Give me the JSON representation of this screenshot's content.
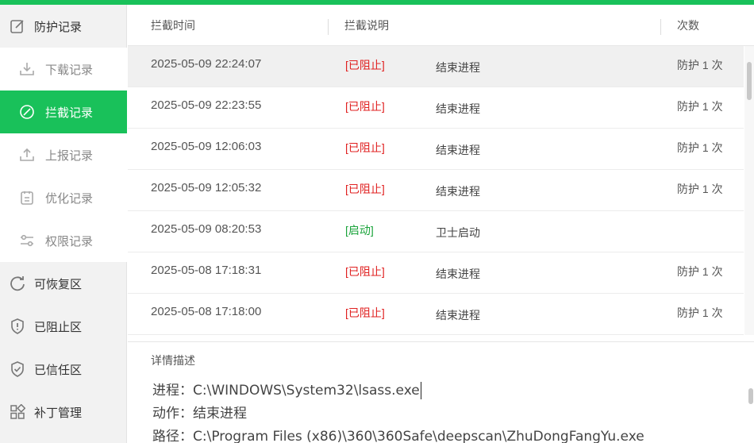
{
  "colors": {
    "accent": "#19c15a",
    "blocked": "#e02020",
    "started": "#19a33a"
  },
  "sidebar": {
    "items": [
      {
        "label": "防护记录",
        "icon": "edit-icon"
      },
      {
        "label": "下载记录",
        "icon": "download-icon"
      },
      {
        "label": "拦截记录",
        "icon": "block-icon"
      },
      {
        "label": "上报记录",
        "icon": "upload-icon"
      },
      {
        "label": "优化记录",
        "icon": "clipboard-icon"
      },
      {
        "label": "权限记录",
        "icon": "sliders-icon"
      },
      {
        "label": "可恢复区",
        "icon": "restore-icon"
      },
      {
        "label": "已阻止区",
        "icon": "shield-alert-icon"
      },
      {
        "label": "已信任区",
        "icon": "shield-check-icon"
      },
      {
        "label": "补丁管理",
        "icon": "apps-icon"
      }
    ]
  },
  "table": {
    "headers": {
      "time": "拦截时间",
      "desc": "拦截说明",
      "count": "次数"
    },
    "rows": [
      {
        "time": "2025-05-09 22:24:07",
        "status": "[已阻止]",
        "desc": "结束进程",
        "count": "防护 1 次"
      },
      {
        "time": "2025-05-09 22:23:55",
        "status": "[已阻止]",
        "desc": "结束进程",
        "count": "防护 1 次"
      },
      {
        "time": "2025-05-09 12:06:03",
        "status": "[已阻止]",
        "desc": "结束进程",
        "count": "防护 1 次"
      },
      {
        "time": "2025-05-09 12:05:32",
        "status": "[已阻止]",
        "desc": "结束进程",
        "count": "防护 1 次"
      },
      {
        "time": "2025-05-09 08:20:53",
        "status": "[启动]",
        "desc": "卫士启动",
        "count": ""
      },
      {
        "time": "2025-05-08 17:18:31",
        "status": "[已阻止]",
        "desc": "结束进程",
        "count": "防护 1 次"
      },
      {
        "time": "2025-05-08 17:18:00",
        "status": "[已阻止]",
        "desc": "结束进程",
        "count": "防护 1 次"
      }
    ]
  },
  "detail": {
    "title": "详情描述",
    "process": "进程：C:\\WINDOWS\\System32\\lsass.exe",
    "action": "动作：结束进程",
    "path": "路径：C:\\Program Files (x86)\\360\\360Safe\\deepscan\\ZhuDongFangYu.exe"
  }
}
